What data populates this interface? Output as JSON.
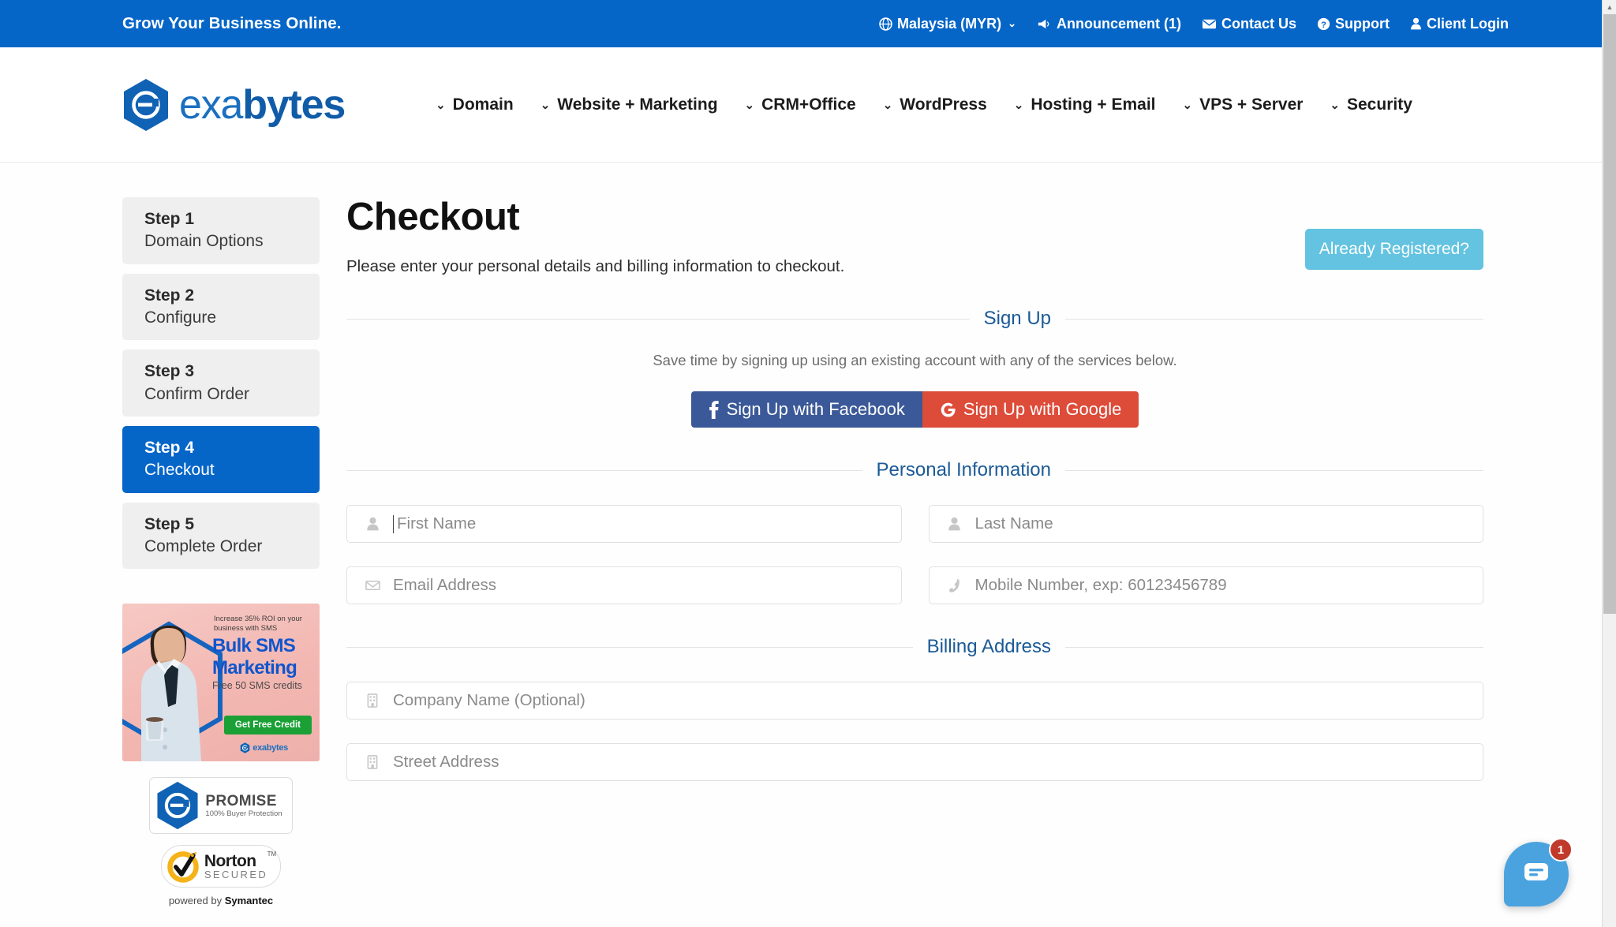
{
  "topbar": {
    "tagline": "Grow Your Business Online.",
    "links": [
      {
        "label": "Malaysia (MYR)",
        "icon": "globe-icon",
        "caret": "⌄"
      },
      {
        "label": "Announcement (1)",
        "icon": "megaphone-icon"
      },
      {
        "label": "Contact Us",
        "icon": "envelope-icon"
      },
      {
        "label": "Support",
        "icon": "question-circle-icon"
      },
      {
        "label": "Client Login",
        "icon": "user-icon"
      }
    ]
  },
  "header": {
    "logo_text_light": "exa",
    "logo_text_bold": "bytes",
    "nav": [
      {
        "label": "Domain"
      },
      {
        "label": "Website + Marketing"
      },
      {
        "label": "CRM+Office"
      },
      {
        "label": "WordPress"
      },
      {
        "label": "Hosting + Email"
      },
      {
        "label": "VPS + Server"
      },
      {
        "label": "Security"
      }
    ]
  },
  "sidebar": {
    "steps": [
      {
        "num": "Step 1",
        "label": "Domain Options",
        "active": false
      },
      {
        "num": "Step 2",
        "label": "Configure",
        "active": false
      },
      {
        "num": "Step 3",
        "label": "Confirm Order",
        "active": false
      },
      {
        "num": "Step 4",
        "label": "Checkout",
        "active": true
      },
      {
        "num": "Step 5",
        "label": "Complete Order",
        "active": false
      }
    ],
    "ad": {
      "eyebrow": "Increase 35% ROI on your business with SMS",
      "title_line1": "Bulk SMS",
      "title_line2": "Marketing",
      "subtitle": "Free 50 SMS credits",
      "cta": "Get Free Credit",
      "brand": "exabytes"
    },
    "badges": {
      "promise_title": "PROMISE",
      "promise_sub": "100% Buyer Protection",
      "norton_title": "Norton",
      "norton_sub": "SECURED",
      "norton_tm": "TM",
      "powered_prefix": "powered by ",
      "powered_brand": "Symantec"
    }
  },
  "main": {
    "title": "Checkout",
    "intro": "Please enter your personal details and billing information to checkout.",
    "already_registered": "Already Registered?",
    "signup": {
      "legend": "Sign Up",
      "helper": "Save time by signing up using an existing account with any of the services below.",
      "facebook_label": "Sign Up with Facebook",
      "facebook_icon": "facebook-icon",
      "google_label": "Sign Up with Google",
      "google_icon": "google-icon"
    },
    "personal": {
      "legend": "Personal Information",
      "fields": [
        {
          "name": "first-name",
          "placeholder": "First Name",
          "value": "",
          "icon": "user-icon",
          "focused": true
        },
        {
          "name": "last-name",
          "placeholder": "Last Name",
          "value": "",
          "icon": "user-icon",
          "focused": false
        },
        {
          "name": "email",
          "placeholder": "Email Address",
          "value": "",
          "icon": "envelope-icon",
          "focused": false
        },
        {
          "name": "mobile",
          "placeholder": "Mobile Number, exp: 60123456789",
          "value": "",
          "icon": "phone-icon",
          "focused": false
        }
      ]
    },
    "billing": {
      "legend": "Billing Address",
      "fields": [
        {
          "name": "company-name",
          "placeholder": "Company Name (Optional)",
          "value": "",
          "icon": "building-icon"
        },
        {
          "name": "street-address",
          "placeholder": "Street Address",
          "value": "",
          "icon": "building-icon"
        }
      ]
    }
  },
  "chat": {
    "badge_count": "1",
    "icon": "chat-bubble-icon"
  },
  "colors": {
    "brand_blue": "#0566c8",
    "accent_light_blue": "#63c3e0",
    "facebook": "#3b5998",
    "google": "#dd4b39",
    "legend_text": "#1b5a96",
    "chat_blue": "#4aa3df",
    "badge_red": "#c0392b"
  }
}
